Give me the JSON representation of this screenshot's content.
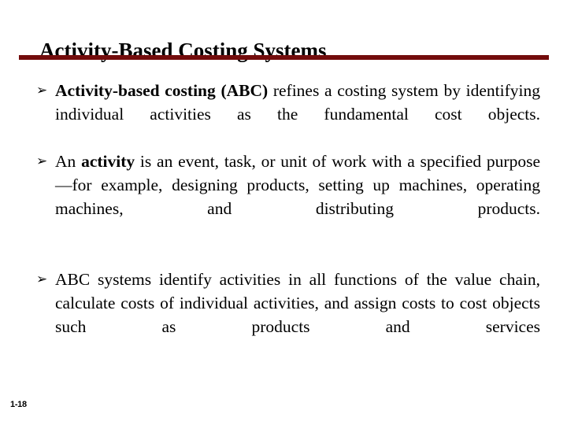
{
  "slide": {
    "title": "Activity-Based Costing Systems",
    "accent_color": "#730C0C",
    "background_color": "#FFFFFF",
    "text_color": "#000000",
    "footer_number": "1-18",
    "bullet_glyph": "➢",
    "bullets": [
      {
        "id": "abc-definition",
        "bold_lead": "Activity-based costing (ABC)",
        "rest": " refines a costing system by identifying individual activities as the fundamental cost objects."
      },
      {
        "id": "activity-definition",
        "lead": "An ",
        "bold_term": "activity",
        "rest": " is an event, task, or unit of work with a specified purpose—for example, designing products, setting up machines, operating machines, and distributing products."
      },
      {
        "id": "abc-systems",
        "text": "ABC systems identify activities in all functions of the value chain, calculate costs of individual activities, and assign costs to cost objects such as products and services"
      }
    ]
  }
}
